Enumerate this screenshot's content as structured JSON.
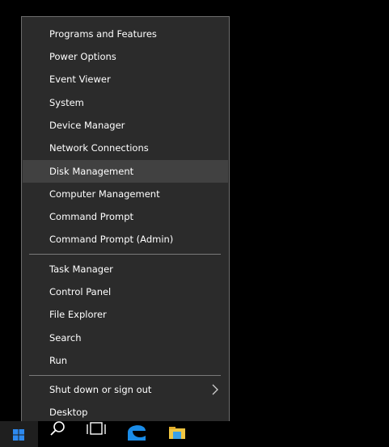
{
  "menu": {
    "items": [
      {
        "label": "Programs and Features"
      },
      {
        "label": "Power Options"
      },
      {
        "label": "Event Viewer"
      },
      {
        "label": "System"
      },
      {
        "label": "Device Manager"
      },
      {
        "label": "Network Connections"
      },
      {
        "label": "Disk Management",
        "selected": true
      },
      {
        "label": "Computer Management"
      },
      {
        "label": "Command Prompt"
      },
      {
        "label": "Command Prompt (Admin)"
      },
      {
        "label": "Task Manager"
      },
      {
        "label": "Control Panel"
      },
      {
        "label": "File Explorer"
      },
      {
        "label": "Search"
      },
      {
        "label": "Run"
      },
      {
        "label": "Shut down or sign out",
        "submenu_icon": "chevron-right-icon"
      },
      {
        "label": "Desktop"
      }
    ]
  },
  "taskbar": {
    "icons": [
      "windows-logo-icon",
      "search-icon",
      "task-view-icon",
      "edge-browser-icon",
      "file-explorer-icon"
    ]
  },
  "colors": {
    "menu_background": "#2b2b2b",
    "menu_border": "#6d6d6d",
    "highlight": "#414141",
    "text": "#ffffff",
    "accent_blue": "#2d89ef"
  }
}
